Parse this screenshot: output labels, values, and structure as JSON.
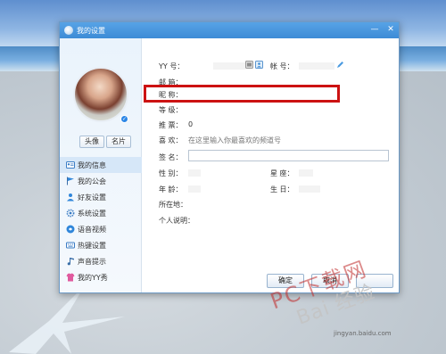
{
  "window": {
    "title": "我的设置",
    "minimize_label": "—",
    "close_label": "✕"
  },
  "left_panel": {
    "avatar_button": "头像",
    "card_button": "名片",
    "nav_items": [
      {
        "label": "我的信息",
        "icon": "profile-card-icon",
        "active": true
      },
      {
        "label": "我的公会",
        "icon": "flag-icon",
        "active": false
      },
      {
        "label": "好友设置",
        "icon": "friend-icon",
        "active": false
      },
      {
        "label": "系统设置",
        "icon": "gear-icon",
        "active": false
      },
      {
        "label": "语音视频",
        "icon": "voice-video-icon",
        "active": false
      },
      {
        "label": "热键设置",
        "icon": "keyboard-icon",
        "active": false
      },
      {
        "label": "声音提示",
        "icon": "music-note-icon",
        "active": false
      },
      {
        "label": "我的YY秀",
        "icon": "clothing-icon",
        "active": false
      }
    ]
  },
  "profile": {
    "yy_label": "YY 号：",
    "account_label": "帐 号：",
    "email_label": "邮 箱：",
    "nickname_label": "昵 称：",
    "level_label": "等 级：",
    "recommend_label": "推 票：",
    "recommend_value": "0",
    "like_label": "喜 欢：",
    "like_placeholder": "在这里输入你最喜欢的频道号",
    "signature_label": "签 名：",
    "gender_label": "性 别：",
    "zodiac_label": "星 座：",
    "age_label": "年 龄：",
    "birthday_label": "生 日：",
    "location_label": "所在地：",
    "bio_label": "个人说明："
  },
  "buttons": {
    "confirm": "确定",
    "cancel": "取消"
  },
  "watermark": {
    "text1": "PC下载网",
    "text2": "Bai 经验",
    "url": "jingyan.baidu.com"
  },
  "colors": {
    "titlebar": "#3d8bd6",
    "highlight": "#cc1212",
    "active_nav": "#d6e7f8"
  }
}
